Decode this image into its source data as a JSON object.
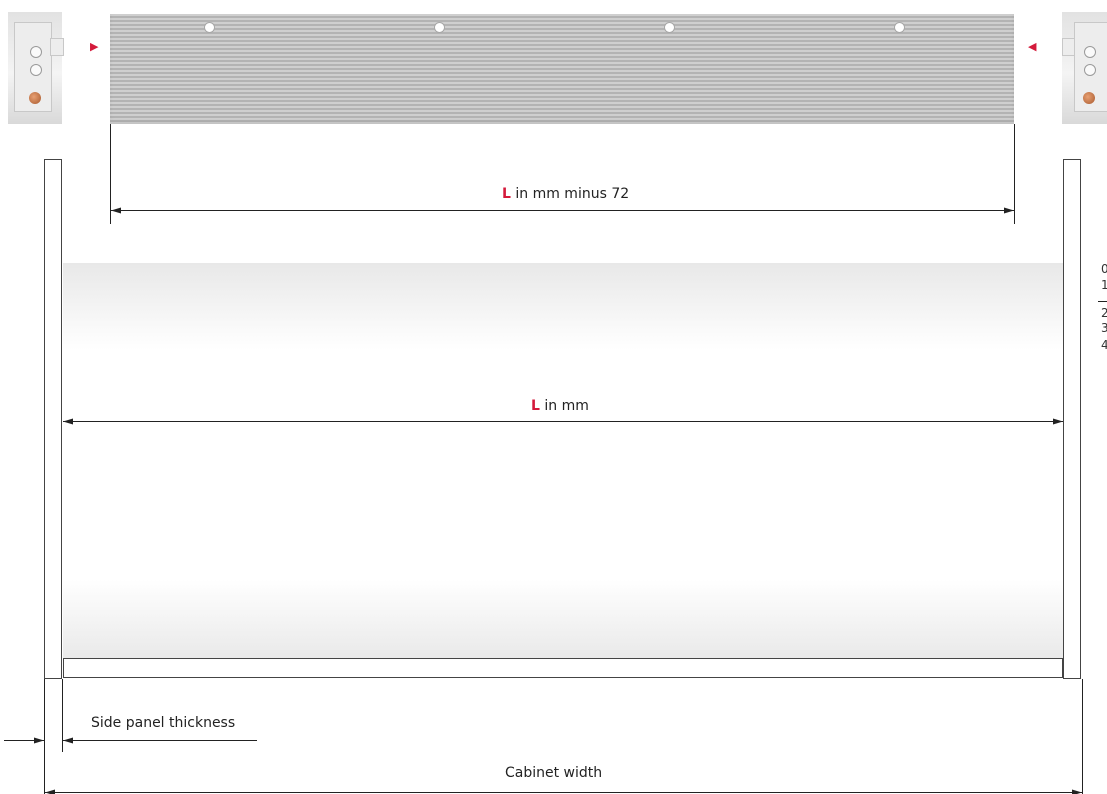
{
  "dimensions": {
    "top": {
      "symbol": "L",
      "text": " in mm minus 72"
    },
    "middle": {
      "symbol": "L",
      "text": " in mm"
    },
    "side_panel": "Side panel thickness",
    "cabinet": "Cabinet width"
  },
  "edge_fragments": [
    "0",
    "1",
    "2",
    "3",
    "4"
  ],
  "colors": {
    "accent": "#d41a3b",
    "line": "#222222"
  }
}
